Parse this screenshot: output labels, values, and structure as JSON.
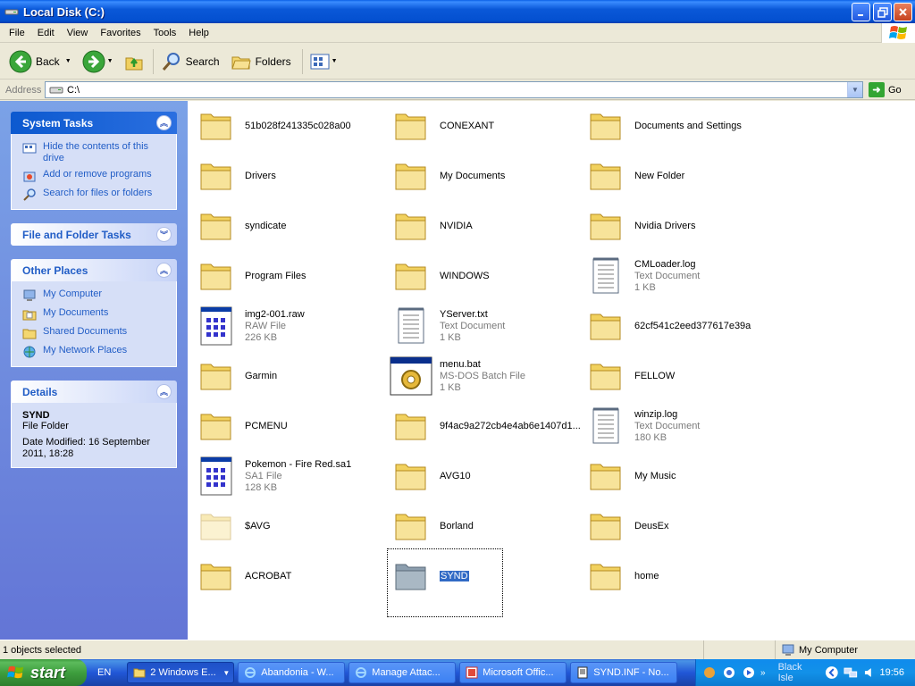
{
  "window": {
    "title": "Local Disk (C:)"
  },
  "menu": [
    "File",
    "Edit",
    "View",
    "Favorites",
    "Tools",
    "Help"
  ],
  "toolbar": {
    "back": "Back",
    "search": "Search",
    "folders": "Folders"
  },
  "address": {
    "label": "Address",
    "value": "C:\\",
    "go": "Go"
  },
  "left_pane": {
    "system_tasks": {
      "title": "System Tasks",
      "items": [
        "Hide the contents of this drive",
        "Add or remove programs",
        "Search for files or folders"
      ]
    },
    "file_folder_tasks": {
      "title": "File and Folder Tasks"
    },
    "other_places": {
      "title": "Other Places",
      "items": [
        "My Computer",
        "My Documents",
        "Shared Documents",
        "My Network Places"
      ]
    },
    "details": {
      "title": "Details",
      "name": "SYND",
      "type": "File Folder",
      "modified": "Date Modified: 16 September 2011, 18:28"
    }
  },
  "files": [
    {
      "name": "51b028f241335c028a00",
      "kind": "folder"
    },
    {
      "name": "CONEXANT",
      "kind": "folder"
    },
    {
      "name": "Documents and Settings",
      "kind": "folder"
    },
    {
      "name": "Drivers",
      "kind": "folder"
    },
    {
      "name": "My Documents",
      "kind": "folder"
    },
    {
      "name": "New Folder",
      "kind": "folder"
    },
    {
      "name": "syndicate",
      "kind": "folder"
    },
    {
      "name": "NVIDIA",
      "kind": "folder"
    },
    {
      "name": "Nvidia Drivers",
      "kind": "folder"
    },
    {
      "name": "Program Files",
      "kind": "folder"
    },
    {
      "name": "WINDOWS",
      "kind": "folder"
    },
    {
      "name": "CMLoader.log",
      "kind": "text",
      "type": "Text Document",
      "size": "1 KB"
    },
    {
      "name": "img2-001.raw",
      "kind": "raw",
      "type": "RAW File",
      "size": "226 KB"
    },
    {
      "name": "YServer.txt",
      "kind": "text",
      "type": "Text Document",
      "size": "1 KB"
    },
    {
      "name": "62cf541c2eed377617e39a",
      "kind": "folder"
    },
    {
      "name": "Garmin",
      "kind": "folder"
    },
    {
      "name": "menu.bat",
      "kind": "bat",
      "type": "MS-DOS Batch File",
      "size": "1 KB"
    },
    {
      "name": "FELLOW",
      "kind": "folder"
    },
    {
      "name": "PCMENU",
      "kind": "folder"
    },
    {
      "name": "9f4ac9a272cb4e4ab6e1407d1...",
      "kind": "folder"
    },
    {
      "name": "winzip.log",
      "kind": "text",
      "type": "Text Document",
      "size": "180 KB"
    },
    {
      "name": "Pokemon - Fire Red.sa1",
      "kind": "raw",
      "type": "SA1 File",
      "size": "128 KB"
    },
    {
      "name": "AVG10",
      "kind": "folder"
    },
    {
      "name": "My Music",
      "kind": "folder"
    },
    {
      "name": "$AVG",
      "kind": "folder-hidden"
    },
    {
      "name": "Borland",
      "kind": "folder"
    },
    {
      "name": "DeusEx",
      "kind": "folder"
    },
    {
      "name": "ACROBAT",
      "kind": "folder"
    },
    {
      "name": "SYND",
      "kind": "folder-selected"
    },
    {
      "name": "home",
      "kind": "folder"
    }
  ],
  "status": {
    "left": "1 objects selected",
    "right": "My Computer"
  },
  "taskbar": {
    "start": "start",
    "lang": "EN",
    "tasks": [
      "2 Windows E...",
      "Abandonia - W...",
      "Manage Attac...",
      "Microsoft Offic...",
      "SYND.INF - No..."
    ],
    "tray_text": "Black Isle",
    "clock": "19:56"
  }
}
